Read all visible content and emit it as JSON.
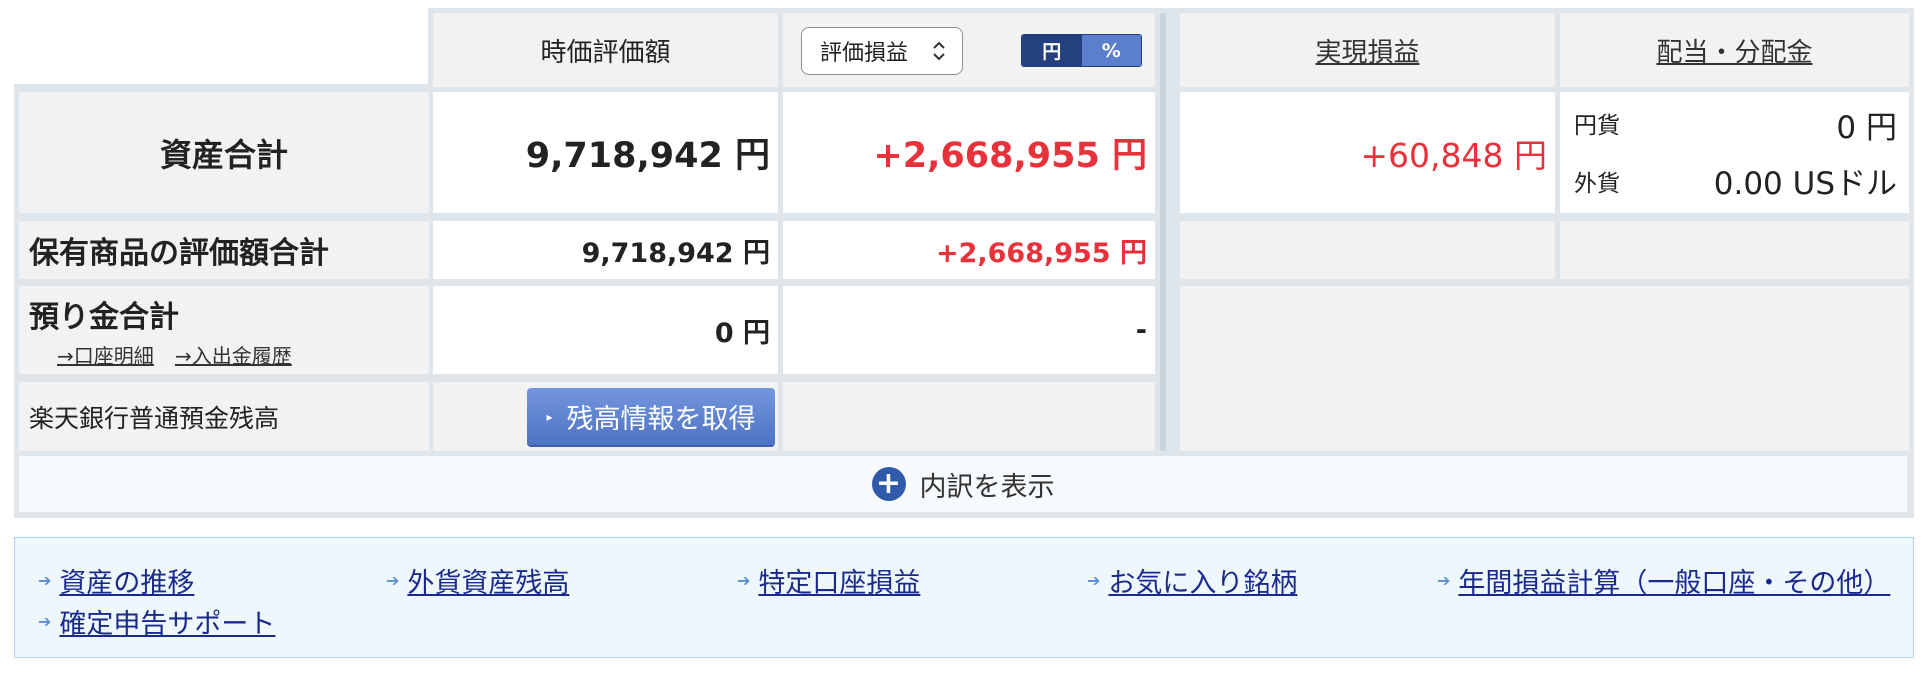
{
  "header": {
    "market_value": "時価評価額",
    "pl_select": "評価損益",
    "toggle_yen": "円",
    "toggle_pct": "%",
    "realized": "実現損益",
    "dividends": "配当・分配金"
  },
  "rows": {
    "total": {
      "label": "資産合計",
      "market_value": "9,718,942 円",
      "unrealized": "+2,668,955 円",
      "realized": "+60,848 円",
      "div_yen_label": "円貨",
      "div_yen_value": "0 円",
      "div_fx_label": "外貨",
      "div_fx_value": "0.00 USドル"
    },
    "holdings": {
      "label": "保有商品の評価額合計",
      "market_value": "9,718,942 円",
      "unrealized": "+2,668,955 円"
    },
    "deposits": {
      "label": "預り金合計",
      "link_account": "→口座明細",
      "link_history": "→入出金履歴",
      "market_value": "0 円",
      "unrealized": "-"
    },
    "bank": {
      "label": "楽天銀行普通預金残高",
      "button": "残高情報を取得"
    }
  },
  "expand": {
    "label": "内訳を表示"
  },
  "links": [
    "資産の推移",
    "外貨資産残高",
    "特定口座損益",
    "お気に入り銘柄",
    "年間損益計算（一般口座・その他）",
    "確定申告サポート"
  ],
  "colors": {
    "positive": "#e8323b",
    "link": "#1a2a8c",
    "toggle_active": "#24407e",
    "toggle_inactive": "#5b7fcd",
    "button": "#5b7fcd"
  }
}
